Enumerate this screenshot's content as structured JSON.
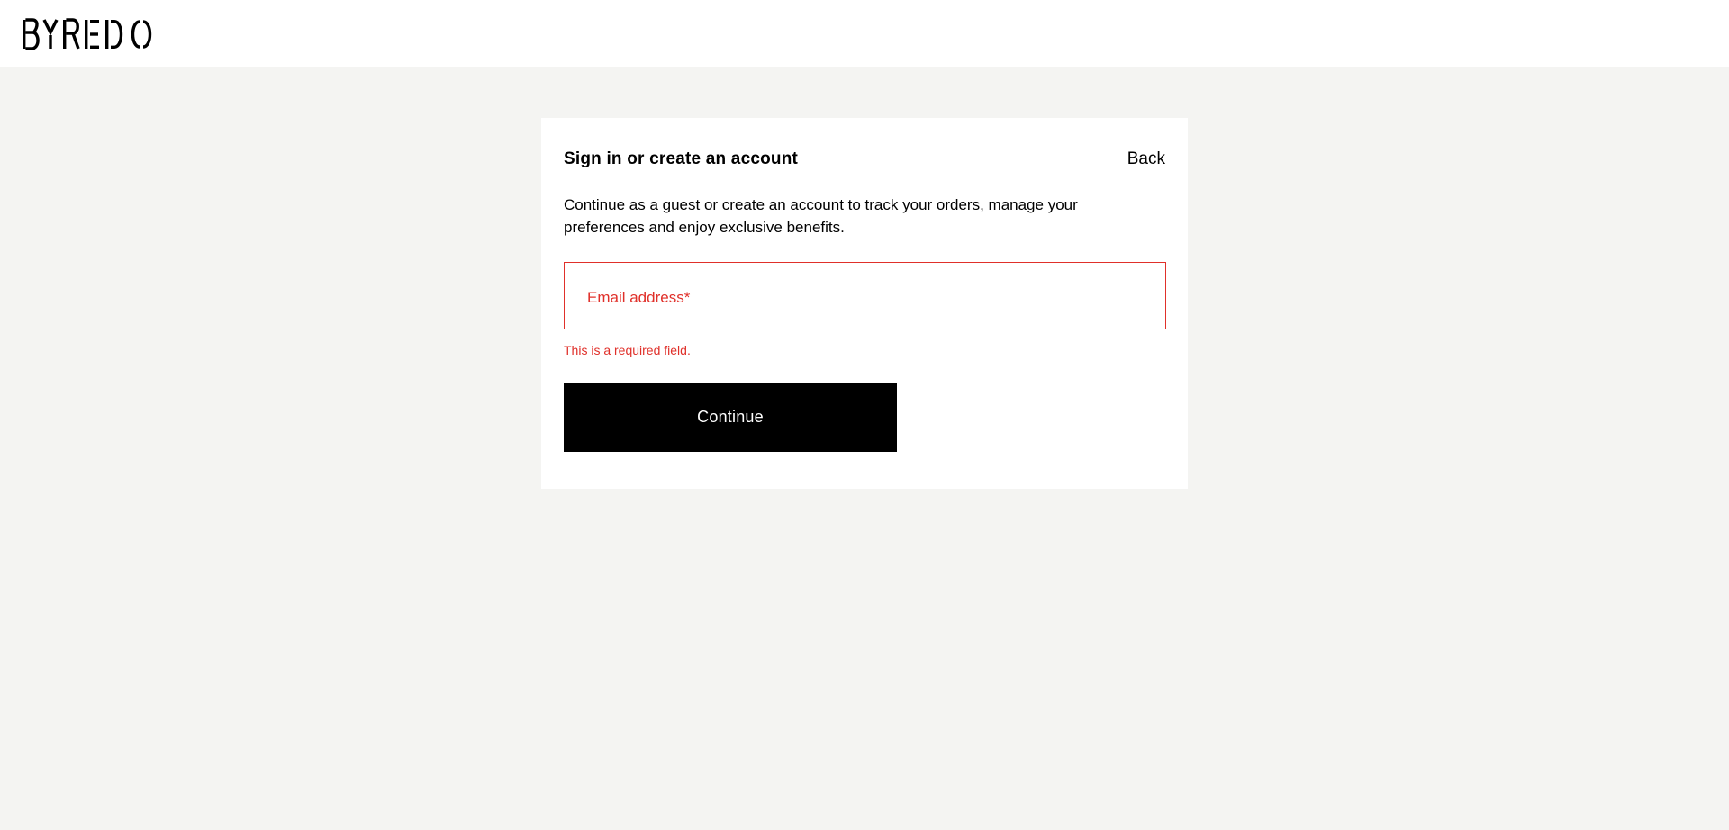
{
  "header": {
    "logo_text": "BYREDO"
  },
  "signin": {
    "title": "Sign in or create an account",
    "back_label": "Back",
    "intro": "Continue as a guest or create an account to track your orders, manage your preferences and enjoy exclusive benefits.",
    "email": {
      "label": "Email address*",
      "value": "",
      "error": "This is a required field."
    },
    "continue_label": "Continue"
  },
  "colors": {
    "page_background": "#f4f4f2",
    "card_background": "#ffffff",
    "error": "#e0302a",
    "button_background": "#000000",
    "button_text": "#ffffff"
  },
  "icons": {
    "logo": "byredo-wordmark-logo"
  }
}
